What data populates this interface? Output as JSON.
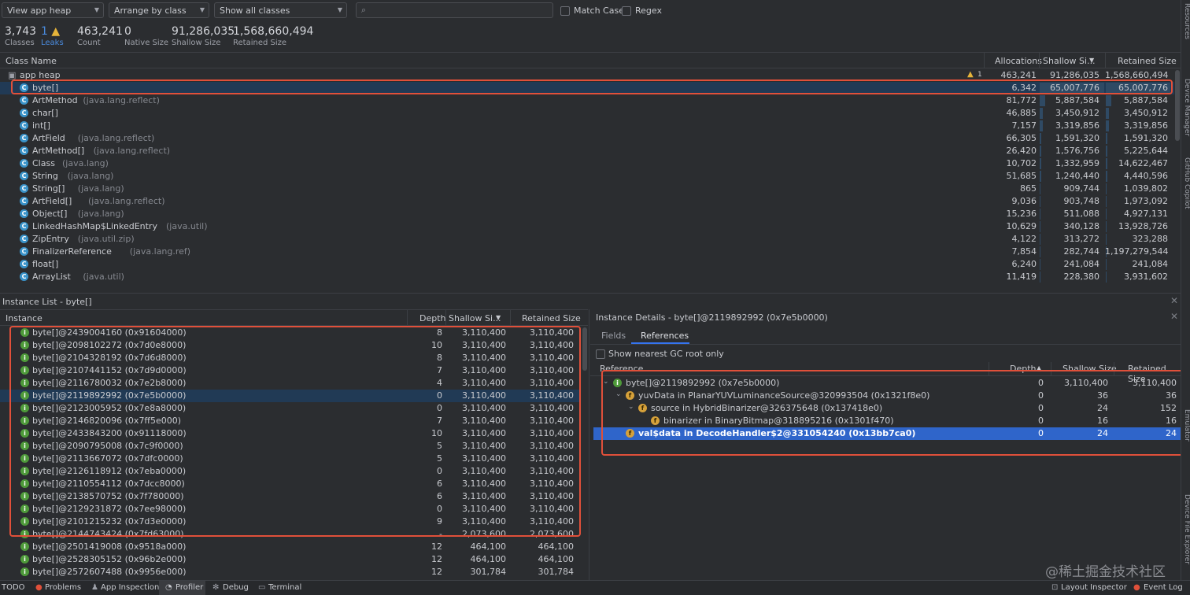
{
  "toolbar": {
    "heap_select": "View app heap",
    "arrange_select": "Arrange by class",
    "filter_select": "Show all classes",
    "search_placeholder": "",
    "match_case": "Match Case",
    "regex": "Regex"
  },
  "summary": {
    "classes": {
      "value": "3,743",
      "label": "Classes"
    },
    "leaks": {
      "value": "1",
      "label": "Leaks"
    },
    "count": {
      "value": "463,241",
      "label": "Count"
    },
    "native": {
      "value": "0",
      "label": "Native Size"
    },
    "shallow": {
      "value": "91,286,035",
      "label": "Shallow Size"
    },
    "retained": {
      "value": "1,568,660,494",
      "label": "Retained Size"
    }
  },
  "class_table": {
    "headers": {
      "name": "Class Name",
      "alloc": "Allocations",
      "shallow": "Shallow Si...",
      "retained": "Retained Size"
    },
    "heap_row": {
      "name": "app heap",
      "warn_count": "1",
      "alloc": "463,241",
      "shallow": "91,286,035",
      "retained": "1,568,660,494"
    },
    "rows": [
      {
        "name": "byte[]",
        "pkg": "",
        "alloc": "6,342",
        "shallow": "65,007,776",
        "retained": "65,007,776",
        "bar": 1.0
      },
      {
        "name": "ArtMethod",
        "pkg": "(java.lang.reflect)",
        "alloc": "81,772",
        "shallow": "5,887,584",
        "retained": "5,887,584",
        "bar": 0.09
      },
      {
        "name": "char[]",
        "pkg": "",
        "alloc": "46,885",
        "shallow": "3,450,912",
        "retained": "3,450,912",
        "bar": 0.05
      },
      {
        "name": "int[]",
        "pkg": "",
        "alloc": "7,157",
        "shallow": "3,319,856",
        "retained": "3,319,856",
        "bar": 0.05
      },
      {
        "name": "ArtField",
        "pkg": "(java.lang.reflect)",
        "alloc": "66,305",
        "shallow": "1,591,320",
        "retained": "1,591,320",
        "bar": 0.03
      },
      {
        "name": "ArtMethod[]",
        "pkg": "(java.lang.reflect)",
        "alloc": "26,420",
        "shallow": "1,576,756",
        "retained": "5,225,644",
        "bar": 0.03
      },
      {
        "name": "Class",
        "pkg": "(java.lang)",
        "alloc": "10,702",
        "shallow": "1,332,959",
        "retained": "14,622,467",
        "bar": 0.02
      },
      {
        "name": "String",
        "pkg": "(java.lang)",
        "alloc": "51,685",
        "shallow": "1,240,440",
        "retained": "4,440,596",
        "bar": 0.02
      },
      {
        "name": "String[]",
        "pkg": "(java.lang)",
        "alloc": "865",
        "shallow": "909,744",
        "retained": "1,039,802",
        "bar": 0.01
      },
      {
        "name": "ArtField[]",
        "pkg": "(java.lang.reflect)",
        "alloc": "9,036",
        "shallow": "903,748",
        "retained": "1,973,092",
        "bar": 0.01
      },
      {
        "name": "Object[]",
        "pkg": "(java.lang)",
        "alloc": "15,236",
        "shallow": "511,088",
        "retained": "4,927,131",
        "bar": 0.01
      },
      {
        "name": "LinkedHashMap$LinkedEntry",
        "pkg": "(java.util)",
        "alloc": "10,629",
        "shallow": "340,128",
        "retained": "13,928,726",
        "bar": 0.01
      },
      {
        "name": "ZipEntry",
        "pkg": "(java.util.zip)",
        "alloc": "4,122",
        "shallow": "313,272",
        "retained": "323,288",
        "bar": 0.0
      },
      {
        "name": "FinalizerReference",
        "pkg": "(java.lang.ref)",
        "alloc": "7,854",
        "shallow": "282,744",
        "retained": "1,197,279,544",
        "bar": 0.0
      },
      {
        "name": "float[]",
        "pkg": "",
        "alloc": "6,240",
        "shallow": "241,084",
        "retained": "241,084",
        "bar": 0.0
      },
      {
        "name": "ArrayList",
        "pkg": "(java.util)",
        "alloc": "11,419",
        "shallow": "228,380",
        "retained": "3,931,602",
        "bar": 0.0
      }
    ]
  },
  "instance_list": {
    "title": "Instance List - byte[]",
    "headers": {
      "instance": "Instance",
      "depth": "Depth",
      "shallow": "Shallow Si...",
      "retained": "Retained Size"
    },
    "rows": [
      {
        "name": "byte[]@2439004160 (0x91604000)",
        "depth": "8",
        "shallow": "3,110,400",
        "retained": "3,110,400"
      },
      {
        "name": "byte[]@2098102272 (0x7d0e8000)",
        "depth": "10",
        "shallow": "3,110,400",
        "retained": "3,110,400"
      },
      {
        "name": "byte[]@2104328192 (0x7d6d8000)",
        "depth": "8",
        "shallow": "3,110,400",
        "retained": "3,110,400"
      },
      {
        "name": "byte[]@2107441152 (0x7d9d0000)",
        "depth": "7",
        "shallow": "3,110,400",
        "retained": "3,110,400"
      },
      {
        "name": "byte[]@2116780032 (0x7e2b8000)",
        "depth": "4",
        "shallow": "3,110,400",
        "retained": "3,110,400"
      },
      {
        "name": "byte[]@2119892992 (0x7e5b0000)",
        "depth": "0",
        "shallow": "3,110,400",
        "retained": "3,110,400"
      },
      {
        "name": "byte[]@2123005952 (0x7e8a8000)",
        "depth": "0",
        "shallow": "3,110,400",
        "retained": "3,110,400"
      },
      {
        "name": "byte[]@2146820096 (0x7ff5e000)",
        "depth": "7",
        "shallow": "3,110,400",
        "retained": "3,110,400"
      },
      {
        "name": "byte[]@2433843200 (0x91118000)",
        "depth": "10",
        "shallow": "3,110,400",
        "retained": "3,110,400"
      },
      {
        "name": "byte[]@2090795008 (0x7c9f0000)",
        "depth": "5",
        "shallow": "3,110,400",
        "retained": "3,110,400"
      },
      {
        "name": "byte[]@2113667072 (0x7dfc0000)",
        "depth": "5",
        "shallow": "3,110,400",
        "retained": "3,110,400"
      },
      {
        "name": "byte[]@2126118912 (0x7eba0000)",
        "depth": "0",
        "shallow": "3,110,400",
        "retained": "3,110,400"
      },
      {
        "name": "byte[]@2110554112 (0x7dcc8000)",
        "depth": "6",
        "shallow": "3,110,400",
        "retained": "3,110,400"
      },
      {
        "name": "byte[]@2138570752 (0x7f780000)",
        "depth": "6",
        "shallow": "3,110,400",
        "retained": "3,110,400"
      },
      {
        "name": "byte[]@2129231872 (0x7ee98000)",
        "depth": "0",
        "shallow": "3,110,400",
        "retained": "3,110,400"
      },
      {
        "name": "byte[]@2101215232 (0x7d3e0000)",
        "depth": "9",
        "shallow": "3,110,400",
        "retained": "3,110,400"
      },
      {
        "name": "byte[]@2144743424 (0x7fd63000)",
        "depth": "-",
        "shallow": "2,073,600",
        "retained": "2,073,600"
      },
      {
        "name": "byte[]@2501419008 (0x9518a000)",
        "depth": "12",
        "shallow": "464,100",
        "retained": "464,100"
      },
      {
        "name": "byte[]@2528305152 (0x96b2e000)",
        "depth": "12",
        "shallow": "464,100",
        "retained": "464,100"
      },
      {
        "name": "byte[]@2572607488 (0x9956e000)",
        "depth": "12",
        "shallow": "301,784",
        "retained": "301,784"
      }
    ]
  },
  "details": {
    "title": "Instance Details - byte[]@2119892992 (0x7e5b0000)",
    "tabs": {
      "fields": "Fields",
      "references": "References"
    },
    "gc_root": "Show nearest GC root only",
    "headers": {
      "reference": "Reference",
      "depth": "Depth",
      "shallow": "Shallow Size",
      "retained": "Retained Size"
    },
    "rows": [
      {
        "text": "byte[]@2119892992 (0x7e5b0000)",
        "depth": "0",
        "shallow": "3,110,400",
        "retained": "3,110,400",
        "level": 0,
        "arrow": "v",
        "icon": "i"
      },
      {
        "text": "yuvData in PlanarYUVLuminanceSource@320993504 (0x1321f8e0)",
        "depth": "0",
        "shallow": "36",
        "retained": "36",
        "level": 1,
        "arrow": "v",
        "icon": "f"
      },
      {
        "text": "source in HybridBinarizer@326375648 (0x137418e0)",
        "depth": "0",
        "shallow": "24",
        "retained": "152",
        "level": 2,
        "arrow": "v",
        "icon": "f"
      },
      {
        "text": "binarizer in BinaryBitmap@318895216 (0x1301f470)",
        "depth": "0",
        "shallow": "16",
        "retained": "16",
        "level": 3,
        "arrow": "",
        "icon": "f"
      },
      {
        "text": "val$data in DecodeHandler$2@331054240 (0x13bb7ca0)",
        "depth": "0",
        "shallow": "24",
        "retained": "24",
        "level": 1,
        "arrow": "",
        "icon": "f"
      }
    ]
  },
  "statusbar": {
    "todo": "TODO",
    "problems": "Problems",
    "app_inspection": "App Inspection",
    "profiler": "Profiler",
    "debug": "Debug",
    "terminal": "Terminal",
    "layout_inspector": "Layout Inspector",
    "event_log": "Event Log"
  },
  "side_strip": {
    "resource": "Resources",
    "device_manager": "Device Manager",
    "github": "GitHub Copilot",
    "emulator": "Emulator",
    "device_file": "Device File Explorer"
  },
  "watermark": "@稀土掘金技术社区",
  "colors": {
    "accent": "#2f65ca",
    "highlight_box": "#e0503a",
    "class_icon": "#3a93c9",
    "instance_icon": "#4e9a3a"
  }
}
